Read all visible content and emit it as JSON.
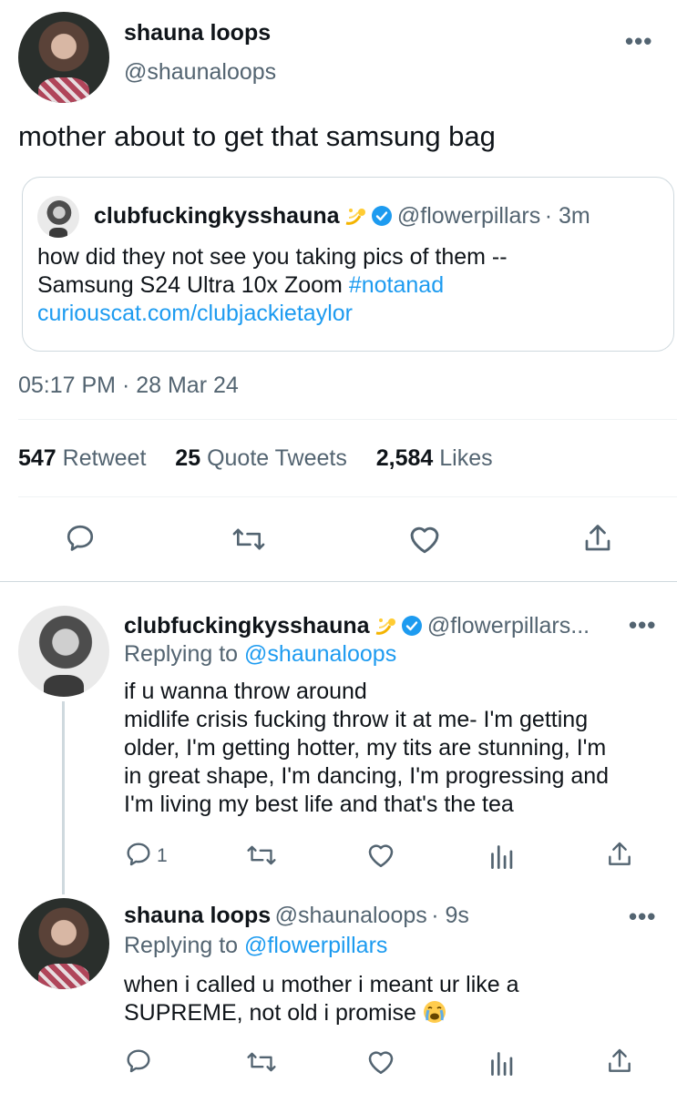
{
  "tweet": {
    "author_name": "shauna loops",
    "author_handle": "@shaunaloops",
    "text": "mother about to get that samsung bag",
    "timestamp": "05:17 PM · 28 Mar 24",
    "more_label": "•••"
  },
  "quote": {
    "author_name": "clubfuckingkysshauna",
    "author_handle": "@flowerpillars",
    "time": "· 3m",
    "line1": "how did they not see you taking pics of them --",
    "line2_text": "Samsung S24 Ultra 10x Zoom ",
    "hashtag": "#notanad",
    "link": "curiouscat.com/clubjackietaylor"
  },
  "stats": [
    {
      "count": "547",
      "label": "Retweet"
    },
    {
      "count": "25",
      "label": "Quote Tweets"
    },
    {
      "count": "2,584",
      "label": "Likes"
    }
  ],
  "replies": [
    {
      "author_name": "clubfuckingkysshauna",
      "author_handle": "@flowerpillars...",
      "replying_prefix": "Replying to",
      "replying_to": "@shaunaloops",
      "lines": [
        "if u wanna throw around",
        "midlife crisis fucking throw it at me- I'm getting",
        "older, I'm getting hotter, my tits are stunning, I'm",
        "in great shape, I'm dancing, I'm progressing and",
        "I'm living my best life and that's the tea"
      ],
      "reply_count": "1",
      "more_label": "•••"
    },
    {
      "author_name": "shauna loops",
      "author_handle": "@shaunaloops",
      "time": "· 9s",
      "replying_prefix": "Replying to",
      "replying_to": "@flowerpillars",
      "lines": [
        "when i called u mother i meant ur like a",
        "SUPREME, not old i promise"
      ],
      "more_label": "•••"
    }
  ],
  "colors": {
    "accent": "#1d9bf0",
    "text": "#0f1419",
    "muted": "#536471",
    "divider": "#eff3f4"
  },
  "icons": [
    "reply-icon",
    "retweet-icon",
    "like-icon",
    "share-icon",
    "analytics-icon",
    "verified-badge-icon",
    "dizzy-emoji-icon",
    "crying-emoji-icon"
  ]
}
